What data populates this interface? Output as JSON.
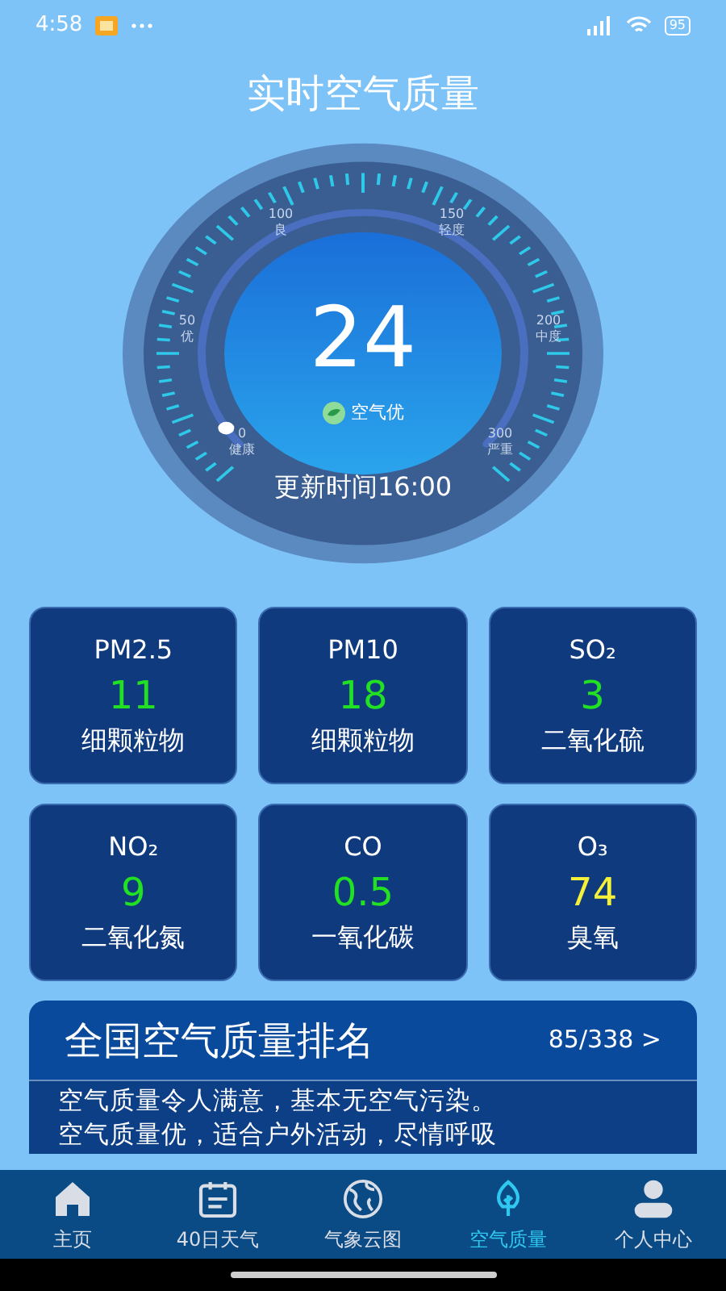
{
  "status_bar": {
    "time": "4:58",
    "battery": "95"
  },
  "title": "实时空气质量",
  "gauge": {
    "value": "24",
    "status": "空气优",
    "updated": "更新时间16:00",
    "scale": [
      {
        "value": "0",
        "label": "健康"
      },
      {
        "value": "50",
        "label": "优"
      },
      {
        "value": "100",
        "label": "良"
      },
      {
        "value": "150",
        "label": "轻度"
      },
      {
        "value": "200",
        "label": "中度"
      },
      {
        "value": "300",
        "label": "严重"
      }
    ]
  },
  "pollutants": [
    {
      "name": "PM2.5",
      "value": "11",
      "desc": "细颗粒物",
      "color": "#22e022"
    },
    {
      "name": "PM10",
      "value": "18",
      "desc": "细颗粒物",
      "color": "#22e022"
    },
    {
      "name": "SO₂",
      "value": "3",
      "desc": "二氧化硫",
      "color": "#22e022"
    },
    {
      "name": "NO₂",
      "value": "9",
      "desc": "二氧化氮",
      "color": "#22e022"
    },
    {
      "name": "CO",
      "value": "0.5",
      "desc": "一氧化碳",
      "color": "#22e022"
    },
    {
      "name": "O₃",
      "value": "74",
      "desc": "臭氧",
      "color": "#f5f03a"
    }
  ],
  "ranking": {
    "title": "全国空气质量排名",
    "rank": "85/338 >",
    "lines": [
      "空气质量令人满意，基本无空气污染。",
      "空气质量优，适合户外活动，尽情呼吸"
    ]
  },
  "nav": [
    {
      "kind": "home",
      "label": "主页",
      "selected": false
    },
    {
      "kind": "calendar",
      "label": "40日天气",
      "selected": false
    },
    {
      "kind": "globe",
      "label": "气象云图",
      "selected": false
    },
    {
      "kind": "leaf",
      "label": "空气质量",
      "selected": true
    },
    {
      "kind": "person",
      "label": "个人中心",
      "selected": false
    }
  ]
}
